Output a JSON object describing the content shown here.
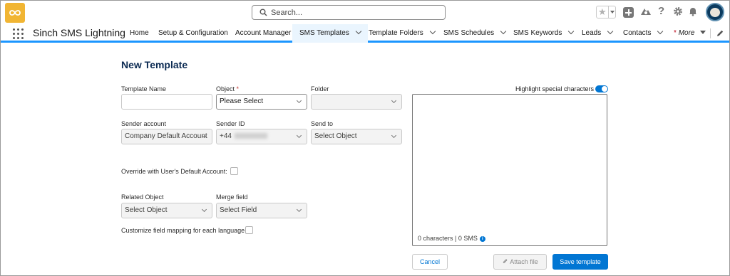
{
  "header": {
    "logo_icon": "sinch-logo-icon",
    "search_placeholder": "Search...",
    "utility_icons": [
      "favorites-star-icon",
      "global-actions-plus-icon",
      "trailhead-icon",
      "help-icon",
      "setup-gear-icon",
      "notifications-bell-icon",
      "user-avatar"
    ]
  },
  "nav": {
    "app_name": "Sinch SMS Lightning",
    "items": [
      {
        "label": "Home",
        "dropdown": false
      },
      {
        "label": "Setup & Configuration",
        "dropdown": false
      },
      {
        "label": "Account Manager",
        "dropdown": false
      },
      {
        "label": "SMS Templates",
        "dropdown": true,
        "active": true
      },
      {
        "label": "Template Folders",
        "dropdown": true
      },
      {
        "label": "SMS Schedules",
        "dropdown": true
      },
      {
        "label": "SMS Keywords",
        "dropdown": true
      },
      {
        "label": "Leads",
        "dropdown": true
      },
      {
        "label": "Contacts",
        "dropdown": true
      }
    ],
    "more": {
      "asterisk": "*",
      "label": "More"
    }
  },
  "form": {
    "title": "New Template",
    "template_name": {
      "label": "Template Name",
      "value": ""
    },
    "object": {
      "label": "Object",
      "required_mark": "*",
      "value": "Please Select"
    },
    "folder": {
      "label": "Folder",
      "value": ""
    },
    "sender_account": {
      "label": "Sender account",
      "value": "Company Default Account"
    },
    "sender_id": {
      "label": "Sender ID",
      "value": "+44"
    },
    "send_to": {
      "label": "Send to",
      "value": "Select Object"
    },
    "override": {
      "label": "Override with User's Default Account:",
      "checked": false
    },
    "related_object": {
      "label": "Related Object",
      "value": "Select Object"
    },
    "merge_field": {
      "label": "Merge field",
      "value": "Select Field"
    },
    "customize_mapping": {
      "label": "Customize field mapping for each language",
      "checked": false
    }
  },
  "editor": {
    "highlight_label": "Highlight special characters",
    "highlight_on": true,
    "counter": "0 characters | 0 SMS",
    "info_glyph": "i"
  },
  "actions": {
    "cancel": "Cancel",
    "attach": "Attach file",
    "save": "Save template"
  },
  "colors": {
    "brand_accent": "#0176d3",
    "logo_bg": "#f1b533",
    "title": "#0b2a52",
    "nav_active_bg": "#eaf5fe",
    "nav_underline": "#1b96ff"
  }
}
